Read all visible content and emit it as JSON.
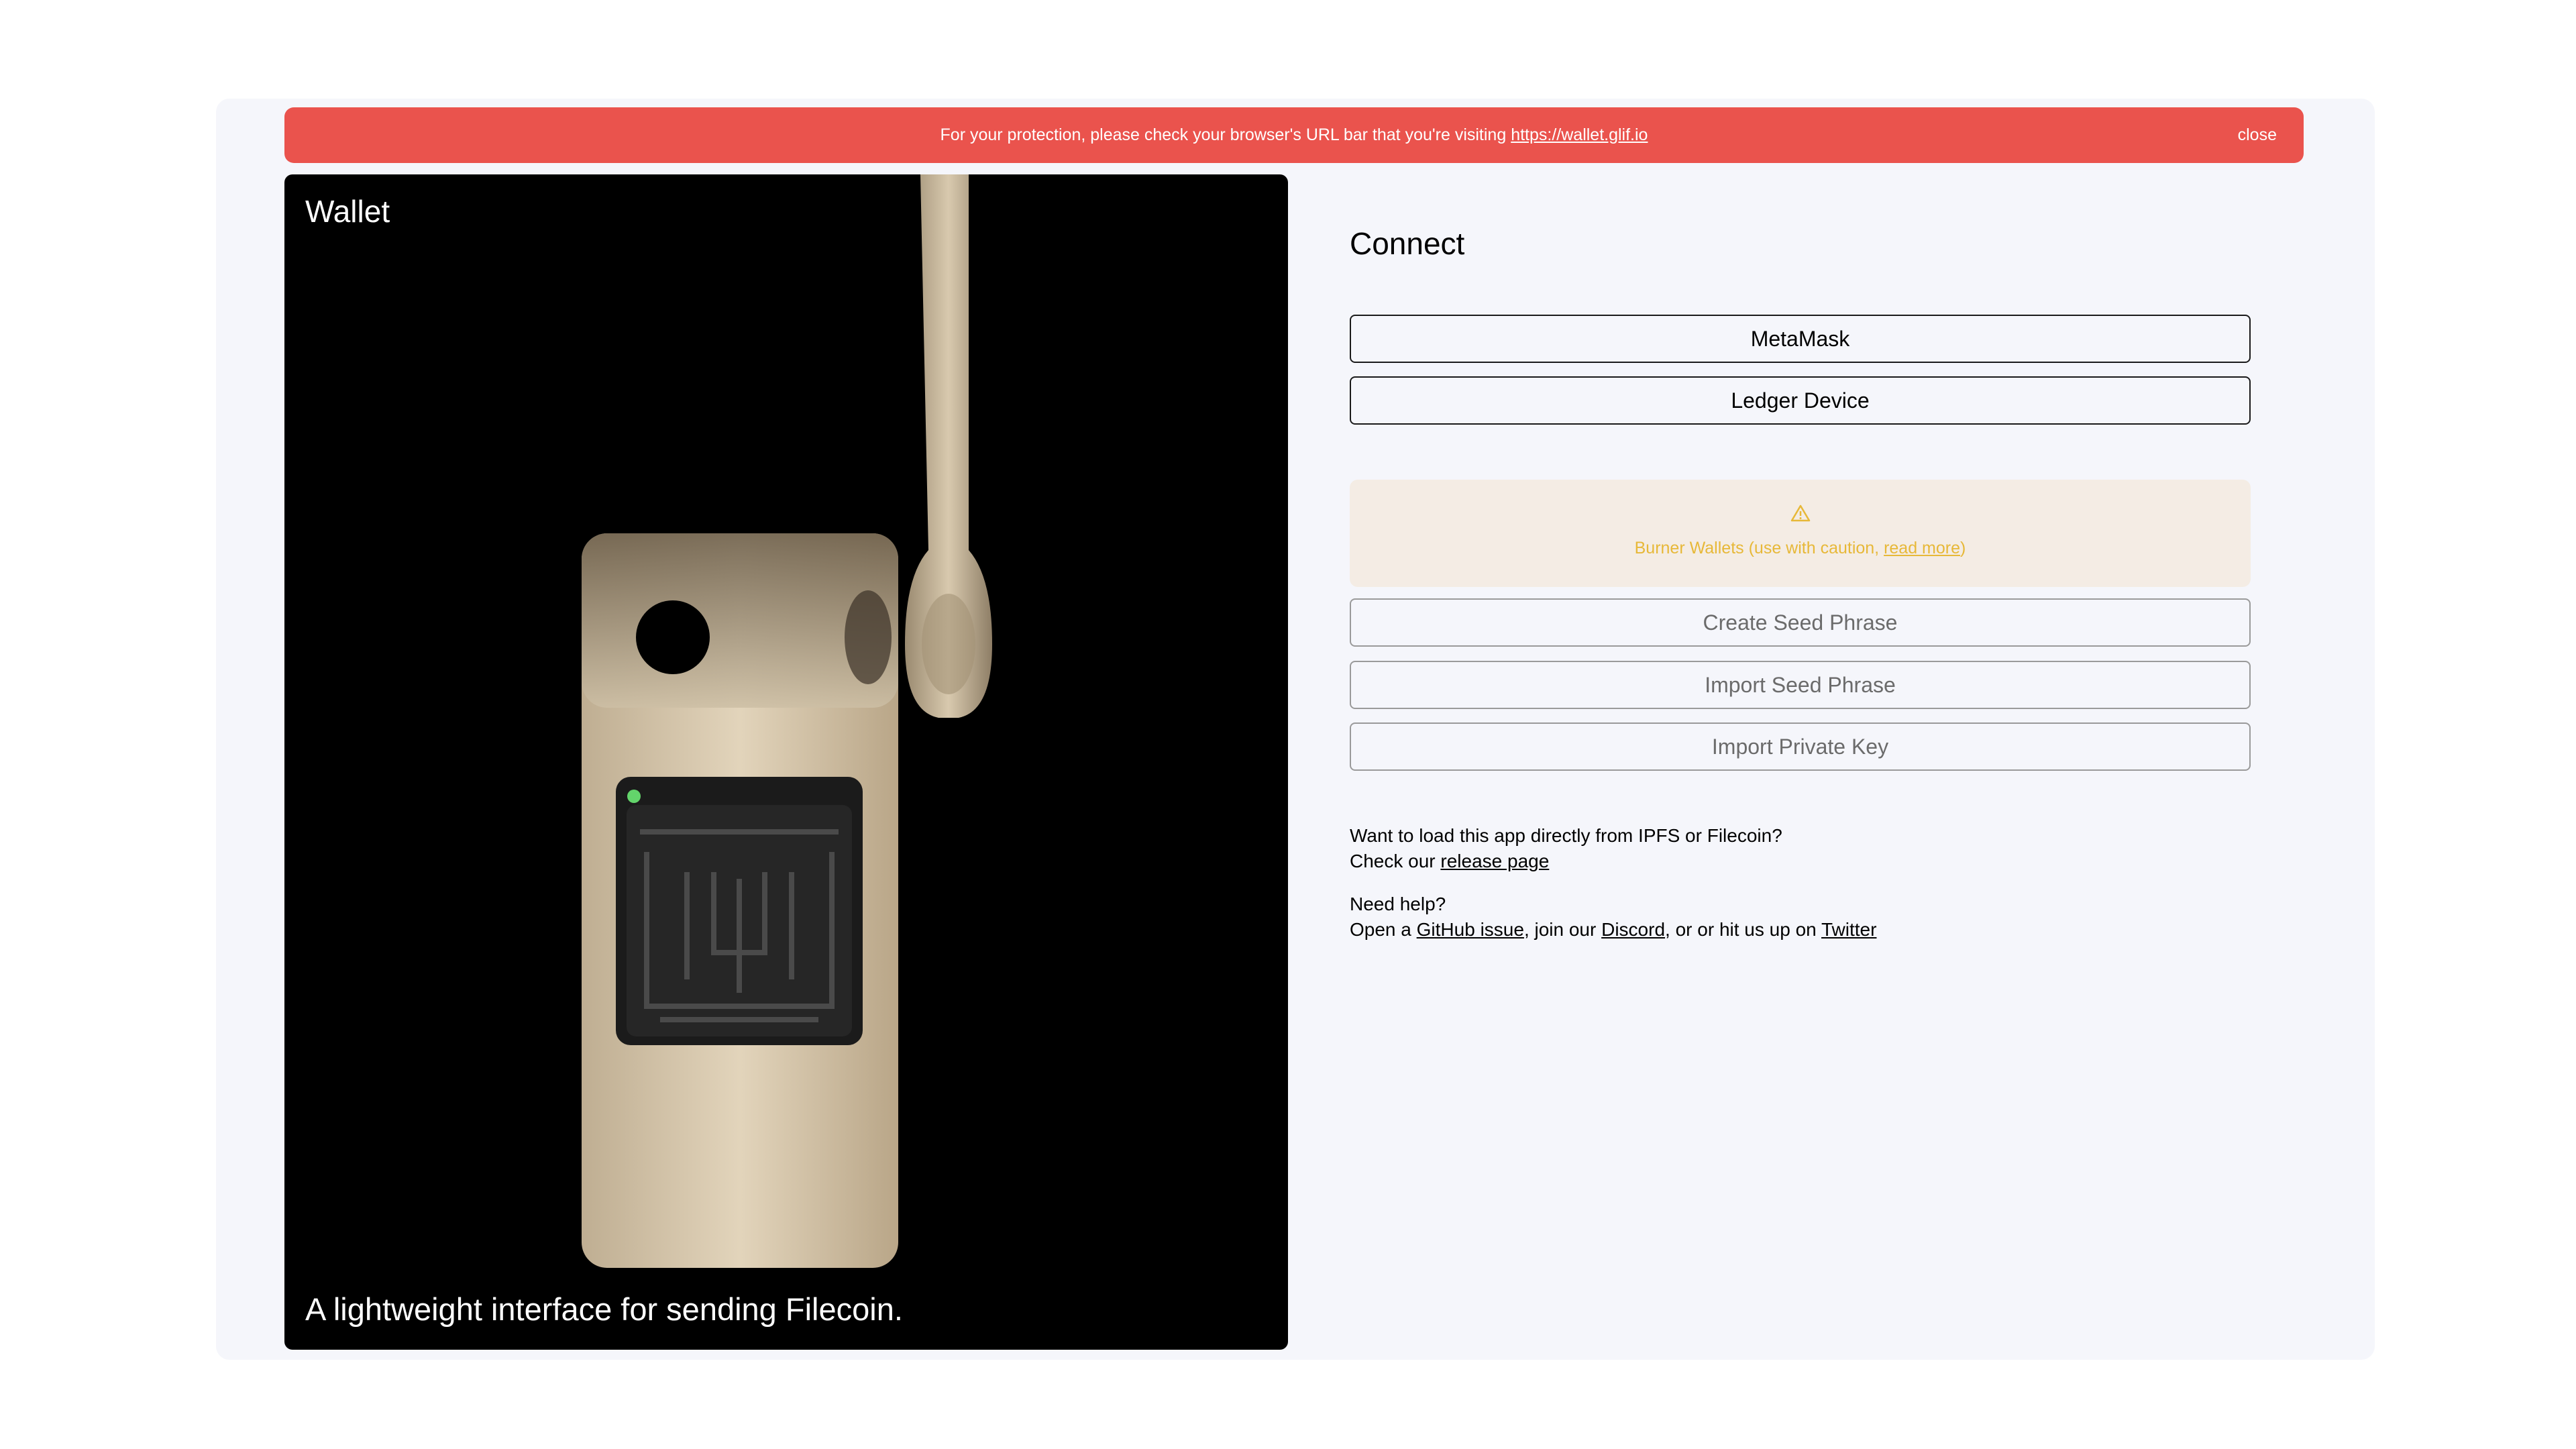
{
  "banner": {
    "message": "For your protection, please check your browser's URL bar that you're visiting ",
    "url_link": "https://wallet.glif.io",
    "close_label": "close"
  },
  "hero": {
    "title": "Wallet",
    "tagline": "A lightweight interface for sending Filecoin."
  },
  "connect": {
    "title": "Connect",
    "primary_buttons": [
      "MetaMask",
      "Ledger Device"
    ],
    "warning": {
      "icon": "warning-triangle-icon",
      "text": "Burner Wallets (use with caution, ",
      "link": "read more",
      "suffix": ")"
    },
    "burner_buttons": [
      "Create Seed Phrase",
      "Import Seed Phrase",
      "Import Private Key"
    ]
  },
  "info": {
    "ipfs_line1": "Want to load this app directly from IPFS or Filecoin?",
    "ipfs_line2_prefix": "Check our ",
    "release_link": "release page",
    "help_line1": "Need help?",
    "help_prefix": "Open a ",
    "github_link": "GitHub issue",
    "help_mid": ", join our ",
    "discord_link": "Discord",
    "help_mid2": ", or or hit us up on ",
    "twitter_link": "Twitter"
  },
  "colors": {
    "banner": "#ea534d",
    "warning_bg": "#f4ece4",
    "warning_text": "#e7b838",
    "page_bg": "#f5f6fb"
  }
}
